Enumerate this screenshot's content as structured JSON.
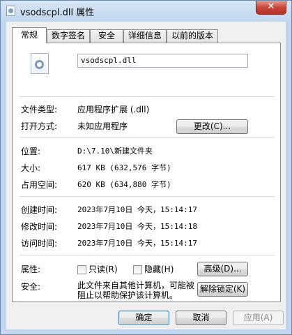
{
  "window": {
    "title": "vsodscpl.dll 属性",
    "close_label": "✕"
  },
  "tabs": [
    "常规",
    "数字签名",
    "安全",
    "详细信息",
    "以前的版本"
  ],
  "general": {
    "file_name": "vsodscpl.dll",
    "type_label": "文件类型:",
    "type_value": "应用程序扩展 (.dll)",
    "open_label": "打开方式:",
    "open_value": "未知应用程序",
    "change_button": "更改(C)...",
    "location_label": "位置:",
    "location_value": "D:\\7.10\\新建文件夹",
    "size_label": "大小:",
    "size_value": "617 KB (632,576 字节)",
    "disk_label": "占用空间:",
    "disk_value": "620 KB (634,880 字节)",
    "created_label": "创建时间:",
    "created_value": "2023年7月10日 今天，15:14:17",
    "modified_label": "修改时间:",
    "modified_value": "2023年7月10日 今天，15:14:18",
    "accessed_label": "访问时间:",
    "accessed_value": "2023年7月10日 今天，15:14:17",
    "attributes_label": "属性:",
    "readonly_label": "只读(R)",
    "hidden_label": "隐藏(H)",
    "advanced_button": "高级(D)...",
    "security_label": "安全:",
    "security_text": "此文件来自其他计算机，可能被阻止以帮助保护该计算机。",
    "unblock_button": "解除锁定(K)"
  },
  "footer": {
    "ok": "确定",
    "cancel": "取消",
    "apply": "应用(A)"
  }
}
